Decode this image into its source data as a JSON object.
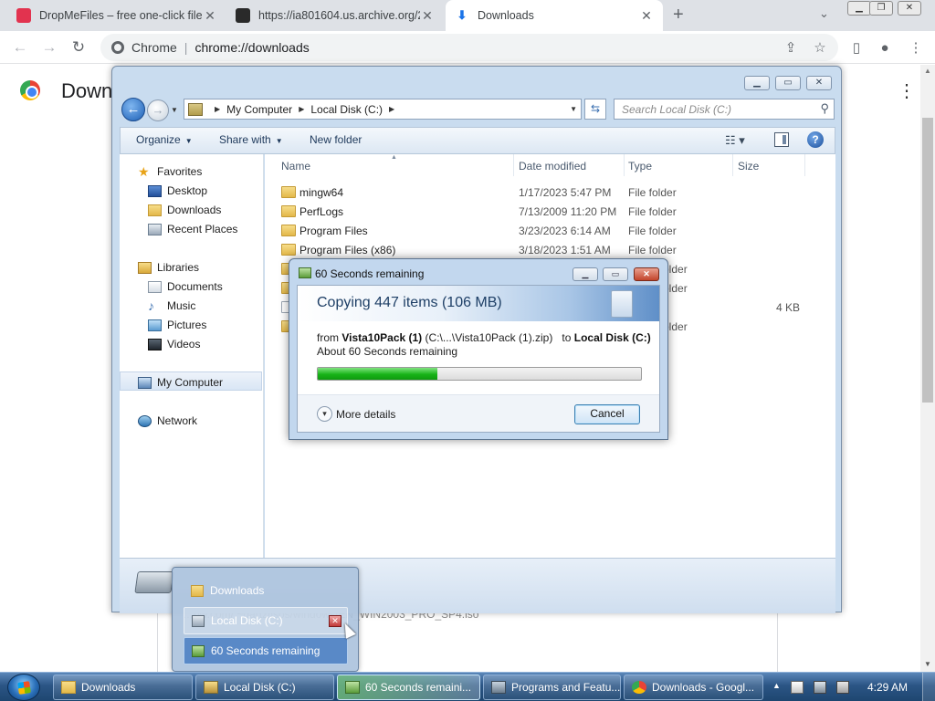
{
  "browser": {
    "tabs": [
      {
        "title": "DropMeFiles – free one-click file",
        "favicon_color": "#e2334f"
      },
      {
        "title": "https://ia801604.us.archive.org/2",
        "favicon_color": "#2a2a2a"
      },
      {
        "title": "Downloads",
        "favicon_color": "#1a73e8"
      }
    ],
    "brand": "Chrome",
    "url": "chrome://downloads",
    "page_title": "Down",
    "page_download_url": "…ow.com/ ~dartz/isos/windows/EN_WIN2003_PRO_SP4.iso"
  },
  "explorer": {
    "breadcrumb": [
      "My Computer",
      "Local Disk (C:)"
    ],
    "search_placeholder": "Search Local Disk (C:)",
    "commands": {
      "organize": "Organize",
      "share_with": "Share with",
      "new_folder": "New folder"
    },
    "nav": {
      "favorites": "Favorites",
      "favorites_items": [
        "Desktop",
        "Downloads",
        "Recent Places"
      ],
      "libraries": "Libraries",
      "libraries_items": [
        "Documents",
        "Music",
        "Pictures",
        "Videos"
      ],
      "computer": "My Computer",
      "network": "Network"
    },
    "columns": {
      "name": "Name",
      "date": "Date modified",
      "type": "Type",
      "size": "Size"
    },
    "files": [
      {
        "name": "mingw64",
        "date": "1/17/2023 5:47 PM",
        "type": "File folder",
        "size": ""
      },
      {
        "name": "PerfLogs",
        "date": "7/13/2009 11:20 PM",
        "type": "File folder",
        "size": ""
      },
      {
        "name": "Program Files",
        "date": "3/23/2023 6:14 AM",
        "type": "File folder",
        "size": ""
      },
      {
        "name": "Program Files (x86)",
        "date": "3/18/2023 1:51 AM",
        "type": "File folder",
        "size": ""
      },
      {
        "name": "",
        "date": "",
        "type": "older",
        "size": ""
      },
      {
        "name": "",
        "date": "",
        "type": "older",
        "size": ""
      },
      {
        "name": "",
        "date": "",
        "type": "",
        "size": "4 KB"
      },
      {
        "name": "",
        "date": "",
        "type": "older",
        "size": ""
      }
    ]
  },
  "copy_dialog": {
    "title": "60 Seconds remaining",
    "heading": "Copying 447 items (106 MB)",
    "from_label": "from",
    "source_name": "Vista10Pack (1)",
    "source_path": "(C:\\...\\Vista10Pack (1).zip)",
    "to_label": "to",
    "dest_name": "Local Disk (C:)",
    "remaining": "About 60 Seconds remaining",
    "progress_fraction": 0.37,
    "more_details": "More details",
    "cancel": "Cancel"
  },
  "taskbar_popup": {
    "items": [
      "Downloads",
      "Local Disk (C:)",
      "60 Seconds remaining"
    ]
  },
  "taskbar": {
    "buttons": [
      "Downloads",
      "Local Disk (C:)",
      "60 Seconds remaini...",
      "Programs and Featu...",
      "Downloads - Googl..."
    ],
    "clock": "4:29 AM"
  }
}
